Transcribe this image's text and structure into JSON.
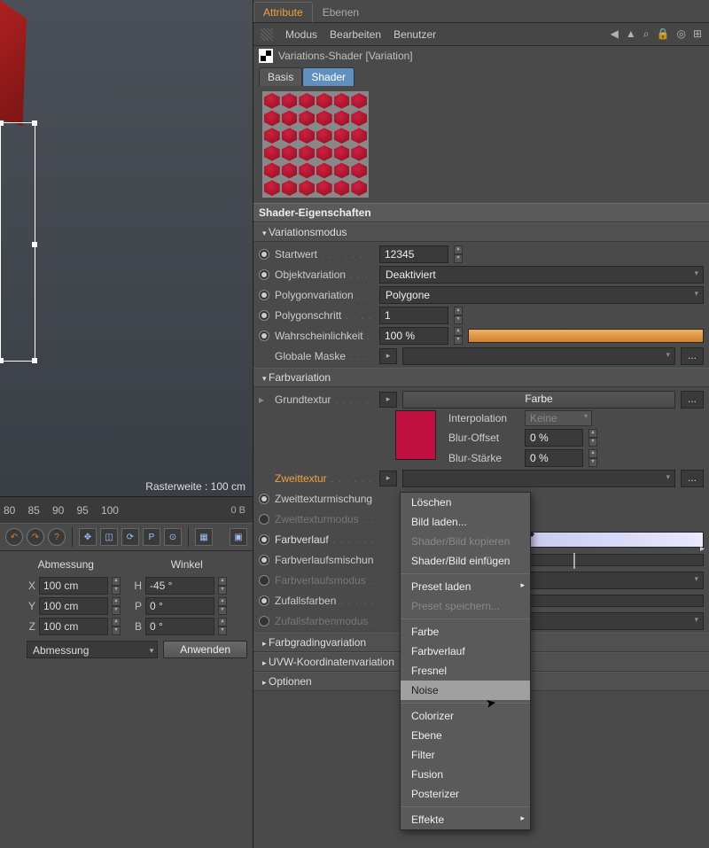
{
  "viewport": {
    "raster": "Rasterweite : 100 cm"
  },
  "timeline": {
    "ticks": [
      "80",
      "85",
      "90",
      "95",
      "100"
    ],
    "info": "0 B"
  },
  "coords": {
    "headers": [
      "Abmessung",
      "Winkel"
    ],
    "rows": [
      {
        "axis": "X",
        "dim": "100 cm",
        "ang_label": "H",
        "ang": "-45 °"
      },
      {
        "axis": "Y",
        "dim": "100 cm",
        "ang_label": "P",
        "ang": "0 °"
      },
      {
        "axis": "Z",
        "dim": "100 cm",
        "ang_label": "B",
        "ang": "0 °"
      }
    ],
    "mode": "Abmessung",
    "apply": "Anwenden"
  },
  "tabs": {
    "attribute": "Attribute",
    "ebenen": "Ebenen"
  },
  "menubar": {
    "modus": "Modus",
    "bearbeiten": "Bearbeiten",
    "benutzer": "Benutzer"
  },
  "object": {
    "title": "Variations-Shader [Variation]"
  },
  "subtabs": {
    "basis": "Basis",
    "shader": "Shader"
  },
  "sections": {
    "shader_props": "Shader-Eigenschaften",
    "variationsmodus": "Variationsmodus",
    "farbvariation": "Farbvariation",
    "farbgrading": "Farbgradingvariation",
    "uvw": "UVW-Koordinatenvariation",
    "optionen": "Optionen"
  },
  "props": {
    "startwert": {
      "label": "Startwert",
      "value": "12345"
    },
    "objektvariation": {
      "label": "Objektvariation",
      "value": "Deaktiviert"
    },
    "polygonvariation": {
      "label": "Polygonvariation",
      "value": "Polygone"
    },
    "polygonschritt": {
      "label": "Polygonschritt",
      "value": "1"
    },
    "wahrscheinlichkeit": {
      "label": "Wahrscheinlichkeit",
      "value": "100 %"
    },
    "globale_maske": {
      "label": "Globale Maske"
    },
    "grundtextur": {
      "label": "Grundtextur",
      "button": "Farbe"
    },
    "interpolation": {
      "label": "Interpolation",
      "value": "Keine"
    },
    "blur_offset": {
      "label": "Blur-Offset",
      "value": "0 %"
    },
    "blur_staerke": {
      "label": "Blur-Stärke",
      "value": "0 %"
    },
    "zweittextur": {
      "label": "Zweittextur"
    },
    "zweittexturmischung": {
      "label": "Zweittexturmischung"
    },
    "zweittexturmodus": {
      "label": "Zweittexturmodus"
    },
    "farbverlauf": {
      "label": "Farbverlauf"
    },
    "farbverlaufsmischung": {
      "label": "Farbverlaufsmischung"
    },
    "farbverlaufsmodus": {
      "label": "Farbverlaufsmodus"
    },
    "zufallsfarben": {
      "label": "Zufallsfarben"
    },
    "zufallsfarbenmodus": {
      "label": "Zufallsfarbenmodus"
    }
  },
  "swatch_color": "#c01040",
  "ctx": {
    "loeschen": "Löschen",
    "bild_laden": "Bild laden...",
    "shader_kopieren": "Shader/Bild kopieren",
    "shader_einfuegen": "Shader/Bild einfügen",
    "preset_laden": "Preset laden",
    "preset_speichern": "Preset speichern...",
    "farbe": "Farbe",
    "farbverlauf": "Farbverlauf",
    "fresnel": "Fresnel",
    "noise": "Noise",
    "colorizer": "Colorizer",
    "ebene": "Ebene",
    "filter": "Filter",
    "fusion": "Fusion",
    "posterizer": "Posterizer",
    "effekte": "Effekte"
  }
}
